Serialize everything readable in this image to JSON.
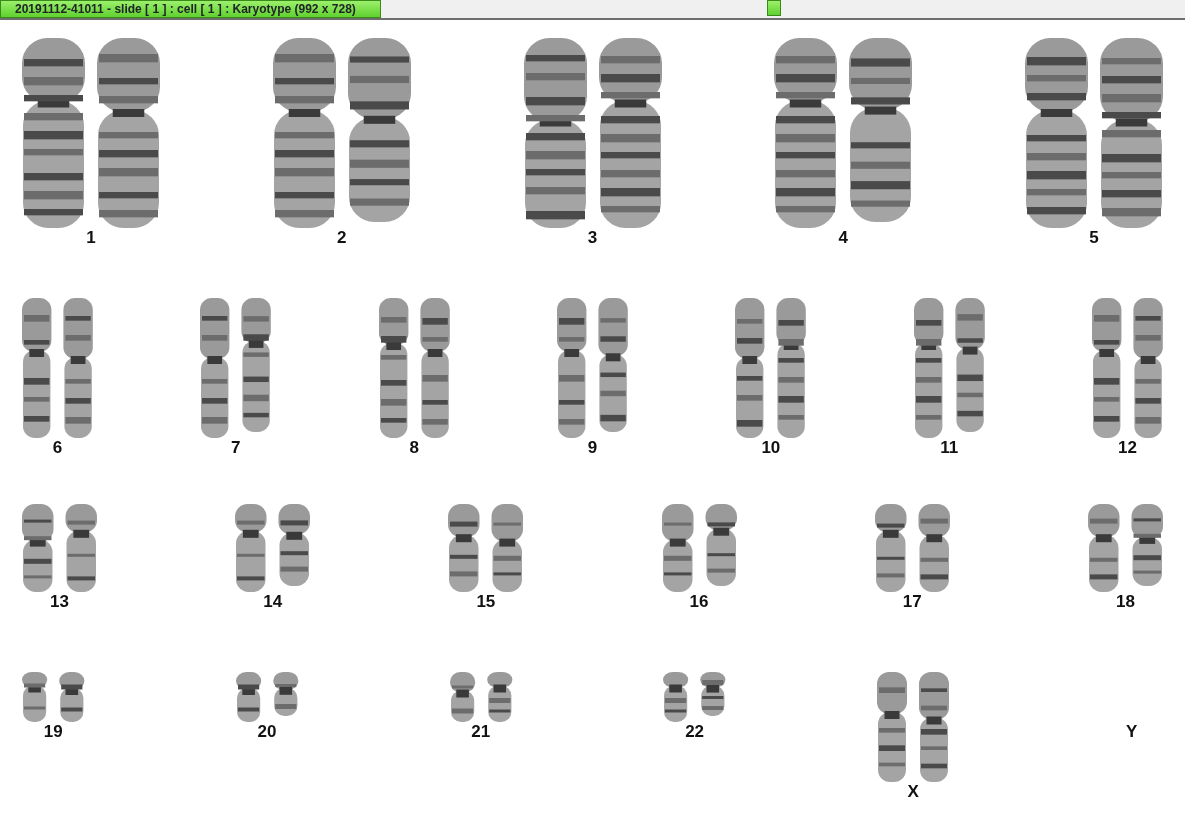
{
  "window": {
    "title": "20191112-41011 - slide [ 1 ] : cell [ 1 ] : Karyotype  (992 x 728)"
  },
  "karyotype": {
    "rows": [
      {
        "pairs": [
          {
            "label": "1",
            "kind": "pair"
          },
          {
            "label": "2",
            "kind": "pair"
          },
          {
            "label": "3",
            "kind": "pair"
          },
          {
            "label": "4",
            "kind": "pair"
          },
          {
            "label": "5",
            "kind": "pair"
          }
        ]
      },
      {
        "pairs": [
          {
            "label": "6",
            "kind": "pair"
          },
          {
            "label": "7",
            "kind": "pair"
          },
          {
            "label": "8",
            "kind": "pair"
          },
          {
            "label": "9",
            "kind": "pair"
          },
          {
            "label": "10",
            "kind": "pair"
          },
          {
            "label": "11",
            "kind": "pair"
          },
          {
            "label": "12",
            "kind": "pair"
          }
        ]
      },
      {
        "pairs": [
          {
            "label": "13",
            "kind": "pair"
          },
          {
            "label": "14",
            "kind": "pair"
          },
          {
            "label": "15",
            "kind": "pair"
          },
          {
            "label": "16",
            "kind": "pair"
          },
          {
            "label": "17",
            "kind": "pair"
          },
          {
            "label": "18",
            "kind": "pair"
          }
        ]
      },
      {
        "pairs": [
          {
            "label": "19",
            "kind": "pair"
          },
          {
            "label": "20",
            "kind": "pair"
          },
          {
            "label": "21",
            "kind": "pair"
          },
          {
            "label": "22",
            "kind": "pair"
          },
          {
            "label": "X",
            "kind": "tall"
          },
          {
            "label": "Y",
            "kind": "empty"
          }
        ]
      }
    ]
  }
}
